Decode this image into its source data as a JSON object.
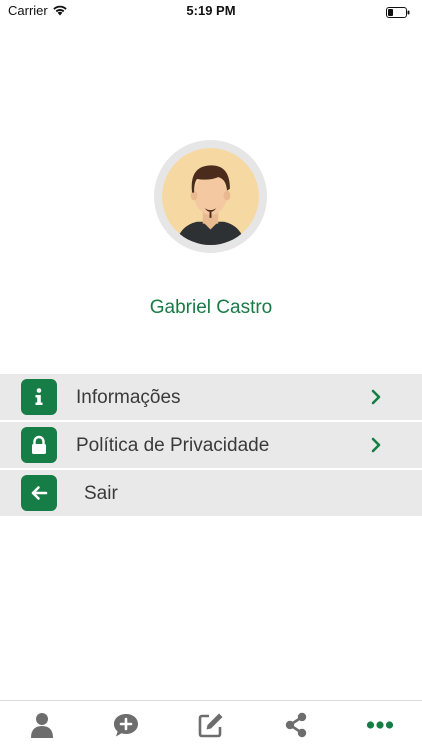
{
  "status_bar": {
    "carrier": "Carrier",
    "time": "5:19 PM"
  },
  "profile": {
    "name": "Gabriel Castro"
  },
  "menu": {
    "items": [
      {
        "label": "Informações",
        "icon": "info-icon",
        "has_chevron": true
      },
      {
        "label": "Política de Privacidade",
        "icon": "lock-icon",
        "has_chevron": true
      },
      {
        "label": "Sair",
        "icon": "back-arrow-icon",
        "has_chevron": false
      }
    ]
  },
  "tab_bar": {
    "tabs": [
      {
        "icon": "person-icon",
        "active": false
      },
      {
        "icon": "chat-add-icon",
        "active": false
      },
      {
        "icon": "edit-icon",
        "active": false
      },
      {
        "icon": "share-icon",
        "active": false
      },
      {
        "icon": "more-icon",
        "active": true
      }
    ]
  },
  "colors": {
    "accent": "#177d46",
    "name_text": "#1a7a46",
    "menu_bg": "#e9e9e9",
    "tab_inactive": "#6d6d6d"
  }
}
